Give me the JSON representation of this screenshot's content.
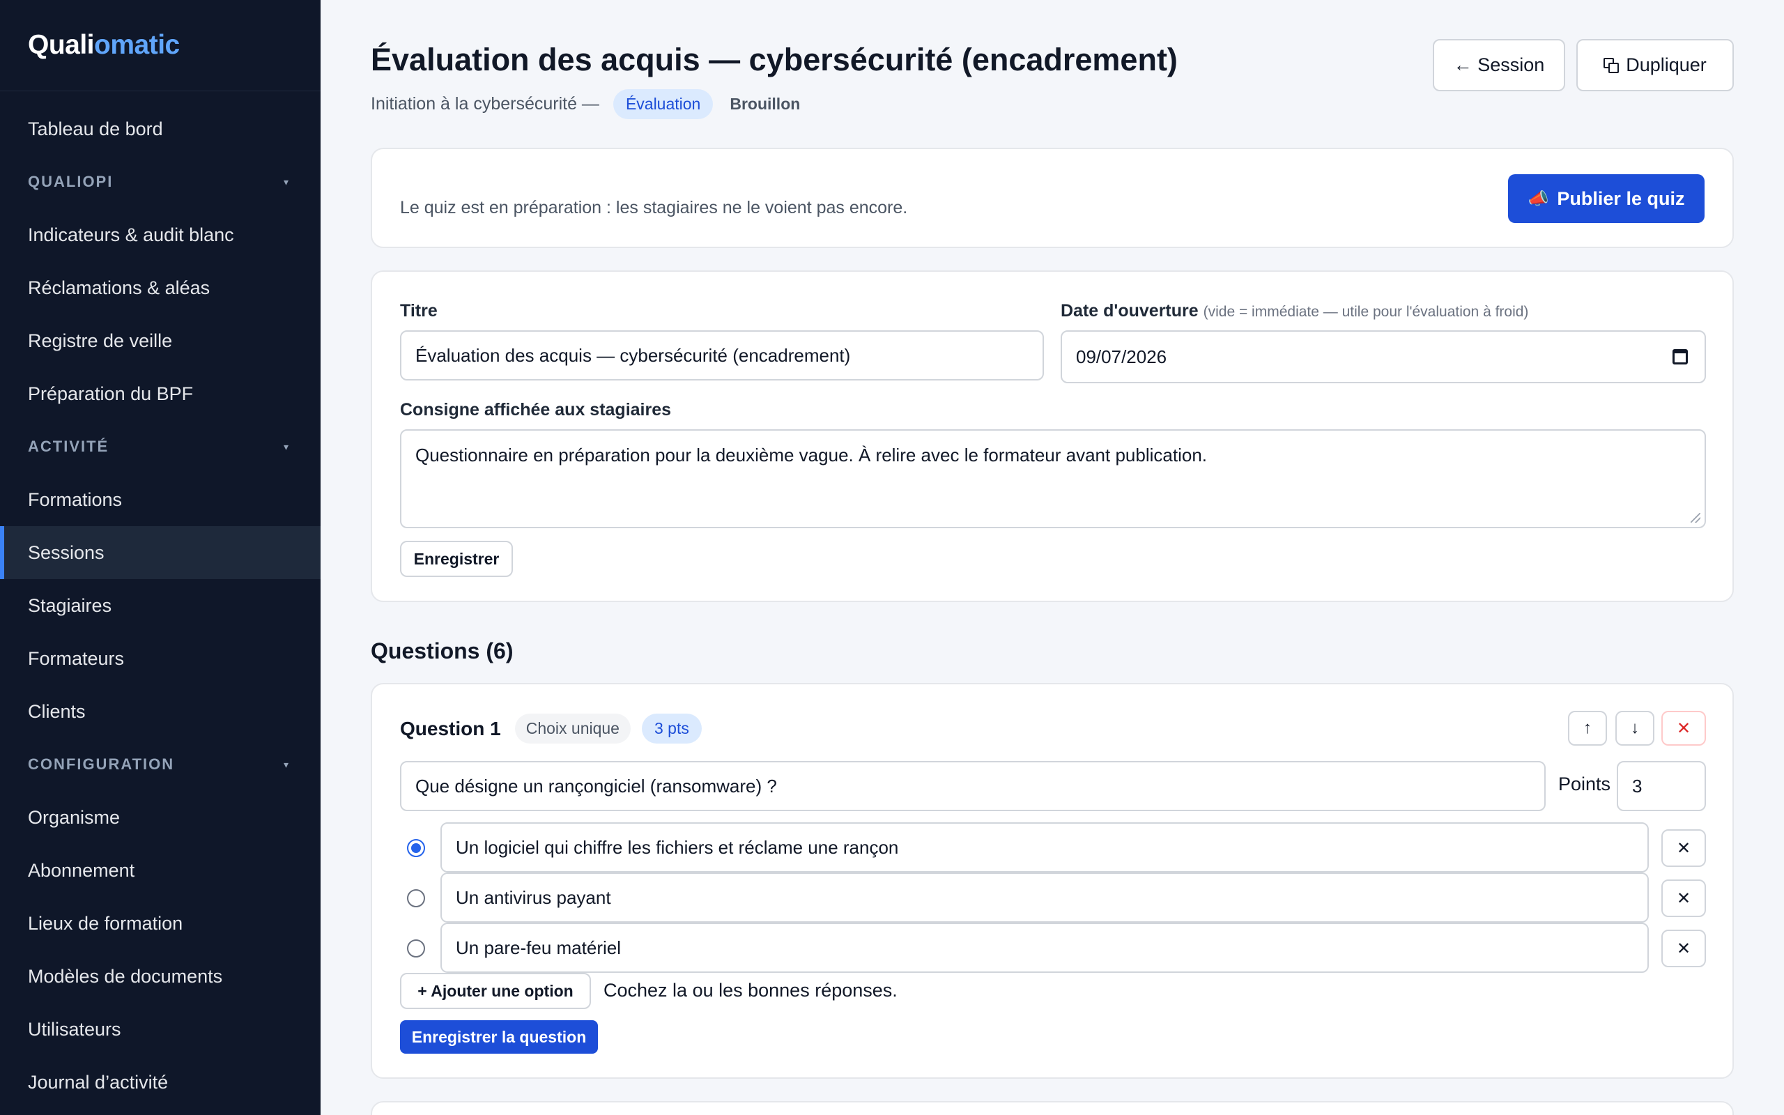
{
  "sidebar": {
    "brand_part1": "Quali",
    "brand_part2": "omatic",
    "items": {
      "dashboard": "Tableau de bord",
      "section_qualiopi": "QUALIOPI",
      "indicators": "Indicateurs & audit blanc",
      "claims": "Réclamations & aléas",
      "watch": "Registre de veille",
      "bpf": "Préparation du BPF",
      "section_activity": "ACTIVITÉ",
      "trainings": "Formations",
      "sessions": "Sessions",
      "trainees": "Stagiaires",
      "trainers": "Formateurs",
      "clients": "Clients",
      "section_config": "CONFIGURATION",
      "organization": "Organisme",
      "subscription": "Abonnement",
      "locations": "Lieux de formation",
      "templates": "Modèles de documents",
      "users": "Utilisateurs",
      "log": "Journal d’activité"
    }
  },
  "header": {
    "title": "Évaluation des acquis — cybersécurité (encadrement)",
    "course": "Initiation à la cybersécurité —",
    "type_badge": "Évaluation",
    "status_badge": "Brouillon",
    "session_button": "← Session",
    "duplicate_button": "Dupliquer"
  },
  "notice": {
    "text": "Le quiz est en préparation : les stagiaires ne le voient pas encore.",
    "publish_icon": "📣",
    "publish_button": "Publier le quiz"
  },
  "form": {
    "title_label": "Titre",
    "title_value": "Évaluation des acquis — cybersécurité (encadrement)",
    "date_label": "Date d'ouverture",
    "date_hint": "(vide = immédiate — utile pour l'évaluation à froid)",
    "date_value": "09/07/2026",
    "instructions_label": "Consigne affichée aux stagiaires",
    "instructions_value": "Questionnaire en préparation pour la deuxième vague. À relire avec le formateur avant publication.",
    "save_button": "Enregistrer"
  },
  "questions": {
    "section_title": "Questions (6)",
    "q1": {
      "label": "Question 1",
      "type_badge": "Choix unique",
      "points_badge": "3 pts",
      "up_button": "↑",
      "down_button": "↓",
      "delete_button": "✕",
      "text": "Que désigne un rançongiciel (ransomware) ?",
      "points_label": "Points",
      "points_value": "3",
      "options": [
        {
          "text": "Un logiciel qui chiffre les fichiers et réclame une rançon",
          "correct": true
        },
        {
          "text": "Un antivirus payant",
          "correct": false
        },
        {
          "text": "Un pare-feu matériel",
          "correct": false
        }
      ],
      "remove_option": "✕",
      "add_option_button": "+ Ajouter une option",
      "help_text": "Cochez la ou les bonnes réponses.",
      "save_button": "Enregistrer la question"
    }
  },
  "colors": {
    "sidebar_bg": "#0f1729",
    "accent": "#1d4ed8",
    "brand_accent": "#60a5fa"
  }
}
